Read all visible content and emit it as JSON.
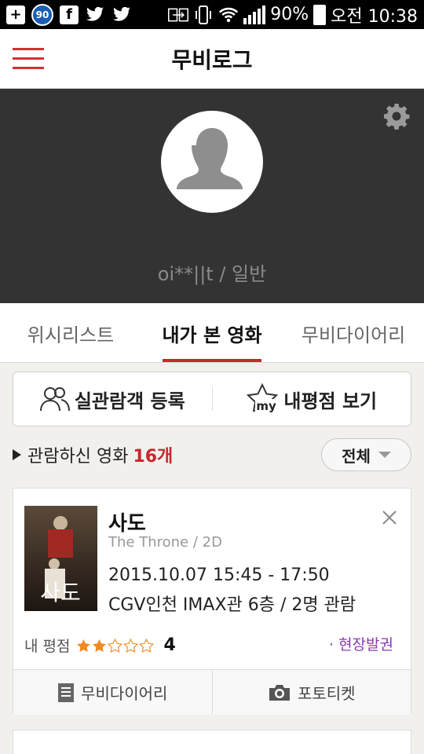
{
  "status_bar": {
    "battery": "90%",
    "time": "오전 10:38",
    "notification_badge": "90"
  },
  "app": {
    "title": "무비로그"
  },
  "profile": {
    "username": "oi**||t / 일반"
  },
  "tabs": [
    {
      "label": "위시리스트"
    },
    {
      "label": "내가 본 영화"
    },
    {
      "label": "무비다이어리"
    }
  ],
  "actions": {
    "register_label": "실관람객 등록",
    "my_rating_label": "내평점 보기",
    "my_icon_text": "my"
  },
  "watched": {
    "label": "관람하신 영화",
    "count": "16개",
    "filter": "전체"
  },
  "movie": {
    "title": "사도",
    "subtitle": "The Throne / 2D",
    "datetime": "2015.10.07 15:45 - 17:50",
    "place": "CGV인천 IMAX관 6층 / 2명 관람",
    "rating_label": "내 평점",
    "rating_value": "4",
    "stars_filled": 2,
    "stars_total": 5,
    "badge": "· 현장발권",
    "poster_text": "사도",
    "diary_label": "무비다이어리",
    "photo_label": "포토티켓"
  },
  "colors": {
    "accent": "#c7282c",
    "star": "#f08a24",
    "badge": "#8b3ab0"
  }
}
